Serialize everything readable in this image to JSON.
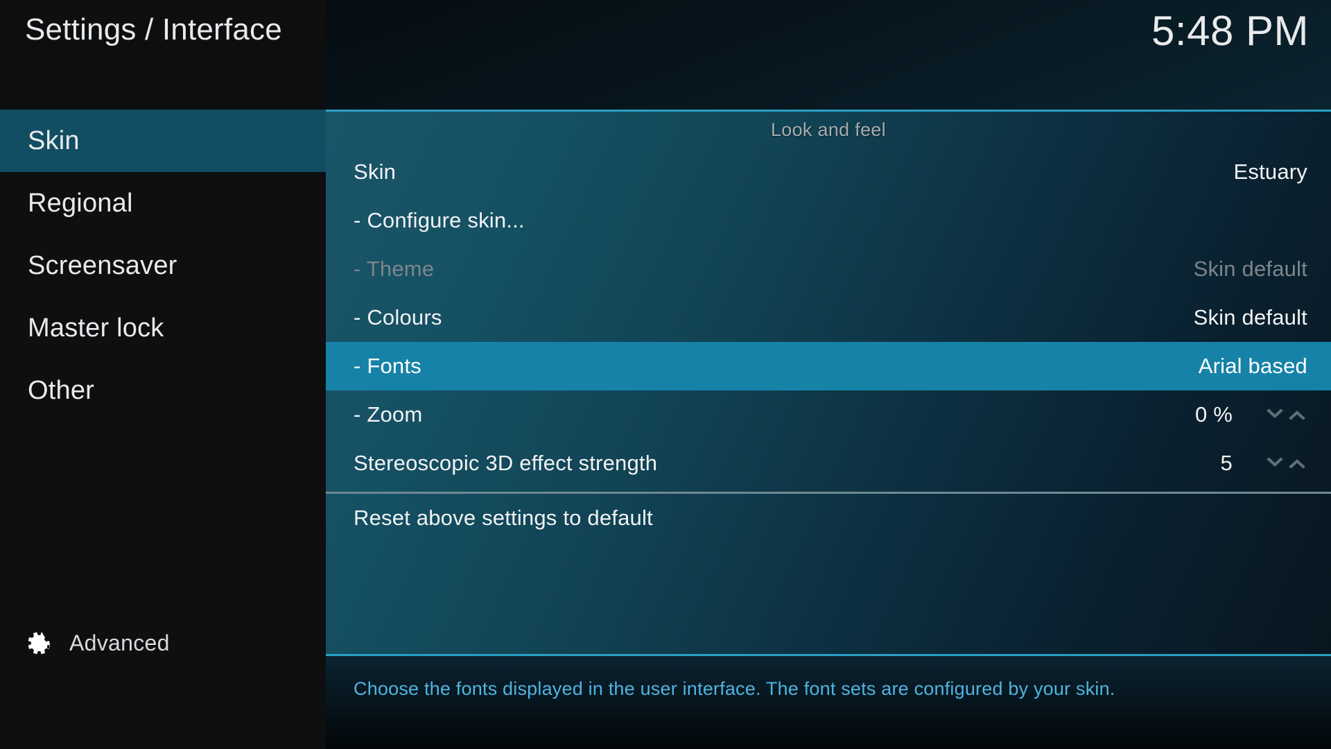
{
  "header": {
    "title": "Settings / Interface",
    "clock": "5:48 PM"
  },
  "sidebar": {
    "items": [
      {
        "label": "Skin",
        "selected": true
      },
      {
        "label": "Regional",
        "selected": false
      },
      {
        "label": "Screensaver",
        "selected": false
      },
      {
        "label": "Master lock",
        "selected": false
      },
      {
        "label": "Other",
        "selected": false
      }
    ],
    "advanced": {
      "label": "Advanced",
      "icon": "gear-icon"
    }
  },
  "main": {
    "category_header": "Look and feel",
    "settings": [
      {
        "label": "Skin",
        "value": "Estuary",
        "disabled": false,
        "selected": false,
        "spinner": false
      },
      {
        "label": "- Configure skin...",
        "value": "",
        "disabled": false,
        "selected": false,
        "spinner": false
      },
      {
        "label": "- Theme",
        "value": "Skin default",
        "disabled": true,
        "selected": false,
        "spinner": false
      },
      {
        "label": "- Colours",
        "value": "Skin default",
        "disabled": false,
        "selected": false,
        "spinner": false
      },
      {
        "label": "- Fonts",
        "value": "Arial based",
        "disabled": false,
        "selected": true,
        "spinner": false
      },
      {
        "label": "- Zoom",
        "value": "0 %",
        "disabled": false,
        "selected": false,
        "spinner": true
      },
      {
        "label": "Stereoscopic 3D effect strength",
        "value": "5",
        "disabled": false,
        "selected": false,
        "spinner": true
      }
    ],
    "reset": {
      "label": "Reset above settings to default"
    }
  },
  "footer": {
    "help_text": "Choose the fonts displayed in the user interface. The font sets are configured by your skin."
  },
  "colors": {
    "accent": "#2a9fc4",
    "selected_row": "#1682a8",
    "sidebar_selected": "#124e63",
    "help_text": "#4fb4e0",
    "disabled_text": "#7d868b",
    "primary_text": "#f2f3f4"
  }
}
